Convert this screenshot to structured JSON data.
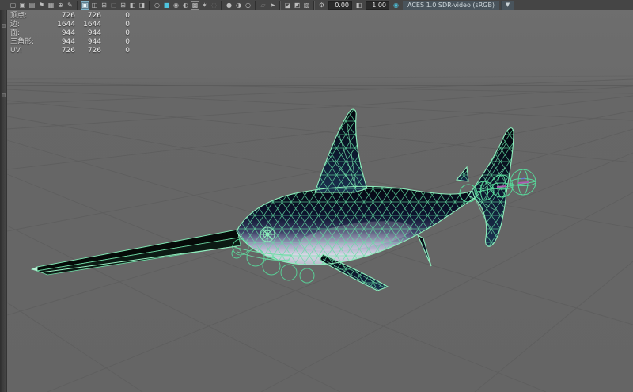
{
  "window": {
    "app": "3d-viewport-panel"
  },
  "toolbar": {
    "icons": [
      {
        "name": "select-camera-icon",
        "glyph": "▢"
      },
      {
        "name": "lock-camera-icon",
        "glyph": "▣"
      },
      {
        "name": "camera-attributes-icon",
        "glyph": "▤"
      },
      {
        "name": "bookmark-icon",
        "glyph": "⚑"
      },
      {
        "name": "image-plane-icon",
        "glyph": "▦"
      },
      {
        "name": "pan-zoom-2d-icon",
        "glyph": "⊕"
      },
      {
        "name": "grease-pencil-icon",
        "glyph": "✎"
      },
      {
        "name": "layout-single-pane-icon",
        "glyph": "▣"
      },
      {
        "name": "layout-two-pane-icon",
        "glyph": "◫"
      },
      {
        "name": "layout-two-stacked-icon",
        "glyph": "⊟"
      },
      {
        "name": "layout-inset-icon",
        "glyph": "▢"
      },
      {
        "name": "layout-four-pane-icon",
        "glyph": "⊞"
      },
      {
        "name": "layout-split-left-icon",
        "glyph": "◧"
      },
      {
        "name": "layout-split-right-icon",
        "glyph": "◨"
      },
      {
        "name": "wireframe-mode-icon",
        "glyph": "○"
      },
      {
        "name": "shaded-mode-icon",
        "glyph": "■"
      },
      {
        "name": "textured-mode-icon",
        "glyph": "◉"
      },
      {
        "name": "lighting-mode-icon",
        "glyph": "◐"
      },
      {
        "name": "checker-texture-icon",
        "glyph": "▩"
      },
      {
        "name": "default-light-icon",
        "glyph": "✶"
      },
      {
        "name": "xray-mode-icon",
        "glyph": "◌"
      },
      {
        "name": "isolate-all-icon",
        "glyph": "●"
      },
      {
        "name": "isolate-selected-icon",
        "glyph": "◑"
      },
      {
        "name": "isolate-none-icon",
        "glyph": "○"
      },
      {
        "name": "film-gate-icon",
        "glyph": "▱"
      },
      {
        "name": "select-cursor-icon",
        "glyph": "➤"
      },
      {
        "name": "copy-buffer-icon",
        "glyph": "◪"
      },
      {
        "name": "paste-buffer-icon",
        "glyph": "◩"
      },
      {
        "name": "snapshot-icon",
        "glyph": "▨"
      },
      {
        "name": "exposure-gear-icon",
        "glyph": "⚙"
      },
      {
        "name": "gamma-icon",
        "glyph": "◧"
      },
      {
        "name": "color-management-icon",
        "glyph": "◉"
      }
    ],
    "exposure_value": "0.00",
    "gamma_value": "1.00",
    "colorspace": "ACES 1.0 SDR-video (sRGB)",
    "dropdown_arrow": "▼"
  },
  "hud": {
    "rows": [
      {
        "label": "顶点:",
        "values": [
          "726",
          "726",
          "0"
        ]
      },
      {
        "label": "边:",
        "values": [
          "1644",
          "1644",
          "0"
        ]
      },
      {
        "label": "面:",
        "values": [
          "944",
          "944",
          "0"
        ]
      },
      {
        "label": "三角形:",
        "values": [
          "944",
          "944",
          "0"
        ]
      },
      {
        "label": "UV:",
        "values": [
          "726",
          "726",
          "0"
        ]
      }
    ]
  },
  "colors": {
    "toolbar_bg": "#454545",
    "viewport_bg": "#6a6a6a",
    "grid_line": "#5d5d5d",
    "horizon_line": "#565656",
    "wireframe_green": "#7fe9b4",
    "control_green": "#58d99b",
    "body_dark": "#070b18",
    "belly_light": "#d8d9e6",
    "accent_blue": "#4ec4de",
    "joint_magenta": "#b05ab0"
  },
  "scene": {
    "model": "swordfish-wireframe"
  }
}
